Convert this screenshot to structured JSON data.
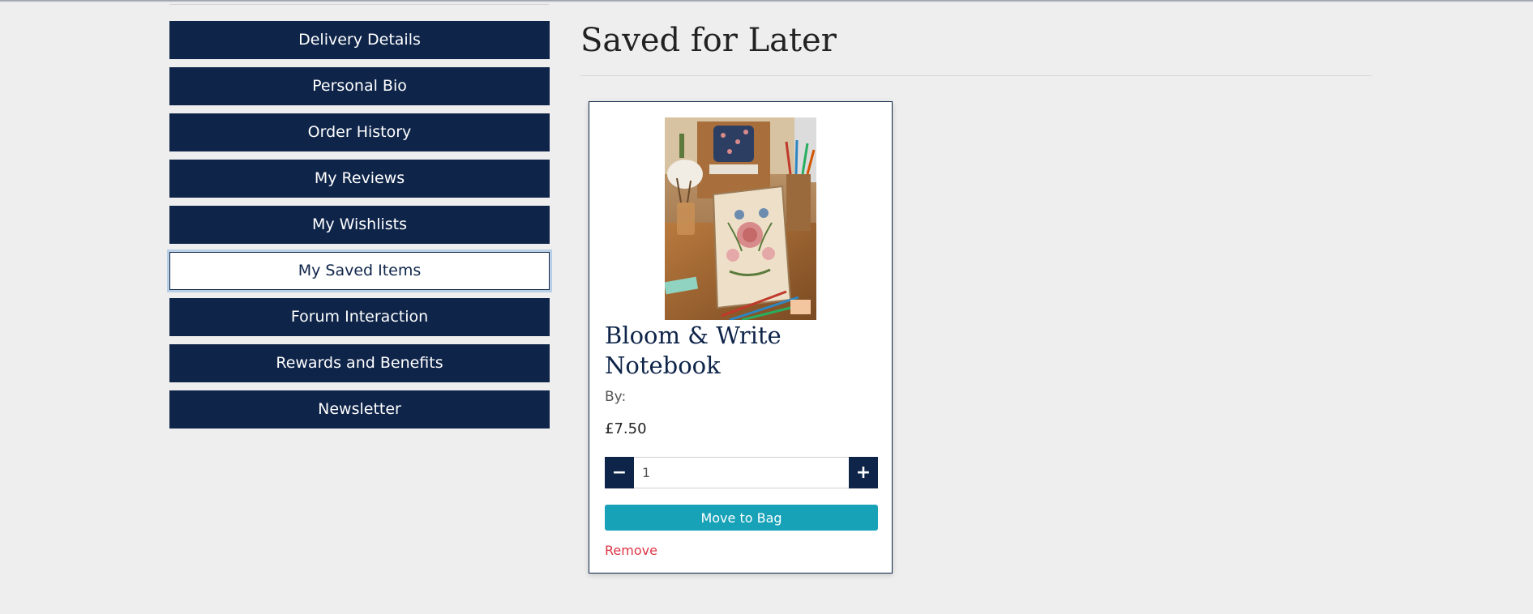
{
  "sidebar": {
    "items": [
      {
        "label": "Delivery Details"
      },
      {
        "label": "Personal Bio"
      },
      {
        "label": "Order History"
      },
      {
        "label": "My Reviews"
      },
      {
        "label": "My Wishlists"
      },
      {
        "label": "My Saved Items",
        "active": true
      },
      {
        "label": "Forum Interaction"
      },
      {
        "label": "Rewards and Benefits"
      },
      {
        "label": "Newsletter"
      }
    ]
  },
  "main": {
    "title": "Saved for Later",
    "items": [
      {
        "name": "Bloom & Write Notebook",
        "author_label": "By:",
        "price": "£7.50",
        "quantity": "1",
        "decrement_icon": "minus-icon",
        "increment_icon": "plus-icon",
        "move_label": "Move to Bag",
        "remove_label": "Remove"
      }
    ]
  },
  "colors": {
    "primary": "#0e2449",
    "accent": "#17a2b8",
    "danger": "#dc3545",
    "background": "#eeeeee"
  }
}
